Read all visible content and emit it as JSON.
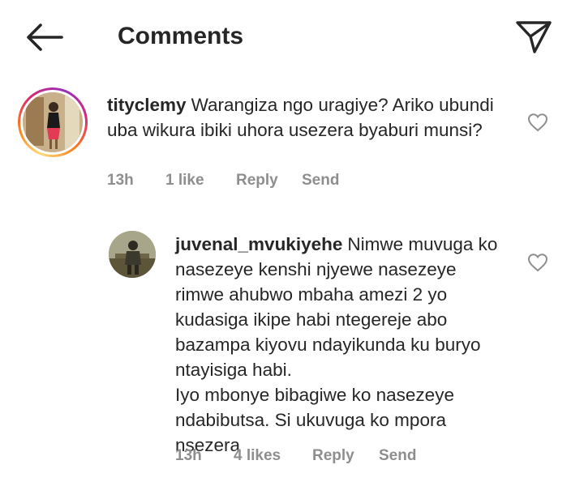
{
  "header": {
    "title": "Comments"
  },
  "comments": [
    {
      "username": "tityclemy",
      "text": "Warangiza ngo uragiye? Ariko ubundi uba wikura ibiki uhora usezera byaburi munsi?",
      "time": "13h",
      "likes": "1 like",
      "reply_label": "Reply",
      "send_label": "Send"
    },
    {
      "username": "juvenal_mvukiyehe",
      "text_line1": "Nimwe muvuga ko nasezeye kenshi njyewe nasezeye rimwe ahubwo mbaha amezi 2 yo kudasiga ikipe habi ntegereje abo bazampa kiyovu ndayikunda ku buryo ntayisiga habi.",
      "text_line2": "Iyo mbonye bibagiwe ko nasezeye ndabibutsa. Si ukuvuga ko mpora nsezera",
      "time": "13h",
      "likes": "4 likes",
      "reply_label": "Reply",
      "send_label": "Send"
    }
  ],
  "colors": {
    "text": "#262626",
    "meta": "#8e8e8e",
    "ring_gradient": [
      "#feda75",
      "#fa7e1e",
      "#d62976",
      "#962fbf"
    ]
  },
  "icons": {
    "back": "arrow-left-icon",
    "send": "paper-plane-icon",
    "like": "heart-outline-icon"
  }
}
